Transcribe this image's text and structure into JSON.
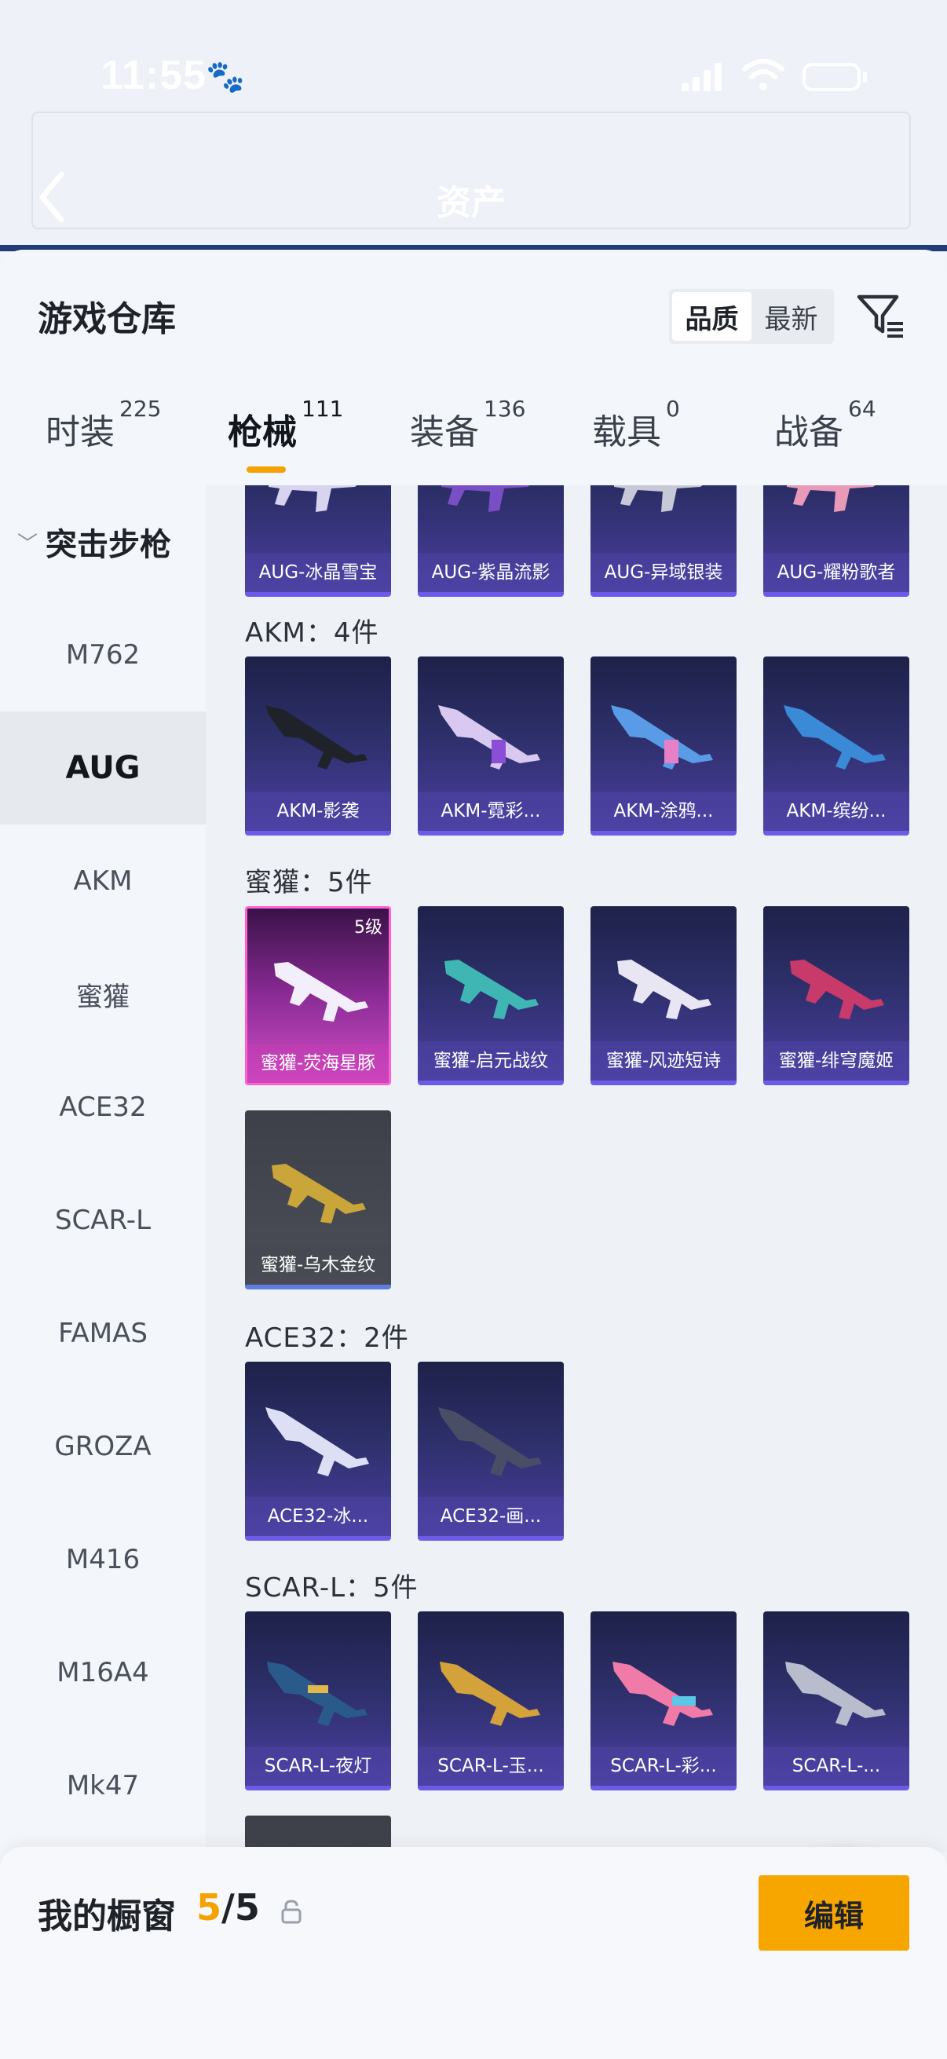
{
  "status_bar": {
    "time": "11:55"
  },
  "background": {
    "title": "资产"
  },
  "sheet": {
    "title": "游戏仓库",
    "sort_options": [
      "品质",
      "最新"
    ],
    "sort_active": "品质"
  },
  "categories": [
    {
      "label": "时装",
      "count": "225"
    },
    {
      "label": "枪械",
      "count": "111"
    },
    {
      "label": "装备",
      "count": "136"
    },
    {
      "label": "载具",
      "count": "0"
    },
    {
      "label": "战备",
      "count": "64"
    }
  ],
  "sidebar": {
    "group": "突击步枪",
    "items": [
      "M762",
      "AUG",
      "AKM",
      "蜜獾",
      "ACE32",
      "SCAR-L",
      "FAMAS",
      "GROZA",
      "M416",
      "M16A4",
      "Mk47"
    ],
    "active": "AUG"
  },
  "sections": {
    "aug_row": [
      "AUG-冰晶雪宝",
      "AUG-紫晶流影",
      "AUG-异域银装",
      "AUG-耀粉歌者"
    ],
    "akm": {
      "title": "AKM：4件",
      "items": [
        "AKM-影袭",
        "AKM-霓彩...",
        "AKM-涂鸦...",
        "AKM-缤纷..."
      ]
    },
    "honeybadger": {
      "title": "蜜獾：5件",
      "items": [
        "蜜獾-荧海星豚",
        "蜜獾-启元战纹",
        "蜜獾-风迹短诗",
        "蜜獾-绯穹魔姬",
        "蜜獾-乌木金纹"
      ],
      "level_badge": "5级"
    },
    "ace32": {
      "title": "ACE32：2件",
      "items": [
        "ACE32-冰...",
        "ACE32-画..."
      ]
    },
    "scarl": {
      "title": "SCAR-L：5件",
      "items": [
        "SCAR-L-夜灯",
        "SCAR-L-玉...",
        "SCAR-L-彩...",
        "SCAR-L-..."
      ]
    }
  },
  "bottom": {
    "label": "我的橱窗",
    "count_current": "5",
    "count_total": "/5",
    "edit_label": "编辑"
  },
  "colors": {
    "accent": "#f5a100",
    "card_purple": "#3b3585",
    "card_pink": "#c040b8"
  }
}
